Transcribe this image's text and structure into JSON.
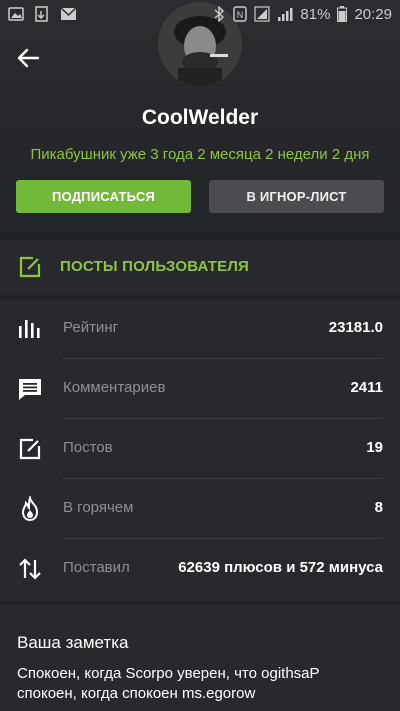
{
  "status_bar": {
    "battery": "81%",
    "time": "20:29"
  },
  "profile": {
    "username": "CoolWelder",
    "tenure": "Пикабушник уже 3 года 2 месяца 2 недели 2 дня",
    "subscribe_label": "ПОДПИСАТЬСЯ",
    "ignore_label": "В ИГНОР-ЛИСТ"
  },
  "posts_section": {
    "label": "ПОСТЫ ПОЛЬЗОВАТЕЛЯ"
  },
  "stats": [
    {
      "icon": "rating-bars-icon",
      "label": "Рейтинг",
      "value": "23181.0"
    },
    {
      "icon": "comment-icon",
      "label": "Комментариев",
      "value": "2411"
    },
    {
      "icon": "edit-icon",
      "label": "Постов",
      "value": "19"
    },
    {
      "icon": "flame-icon",
      "label": "В горячем",
      "value": "8"
    },
    {
      "icon": "up-down-arrows-icon",
      "label": "Поставил",
      "value": "62639 плюсов и 572 минуса"
    }
  ],
  "note": {
    "title": "Ваша заметка",
    "text": "Спокоен, когда Scorpo уверен,  что ogithsaP\nспокоен, когда  спокоен ms.egorow"
  },
  "colors": {
    "accent": "#8cc63f",
    "subscribe_bg": "#72b93a",
    "ignore_bg": "#4a4c4f",
    "background": "#1f2226",
    "panel": "#27292d"
  }
}
